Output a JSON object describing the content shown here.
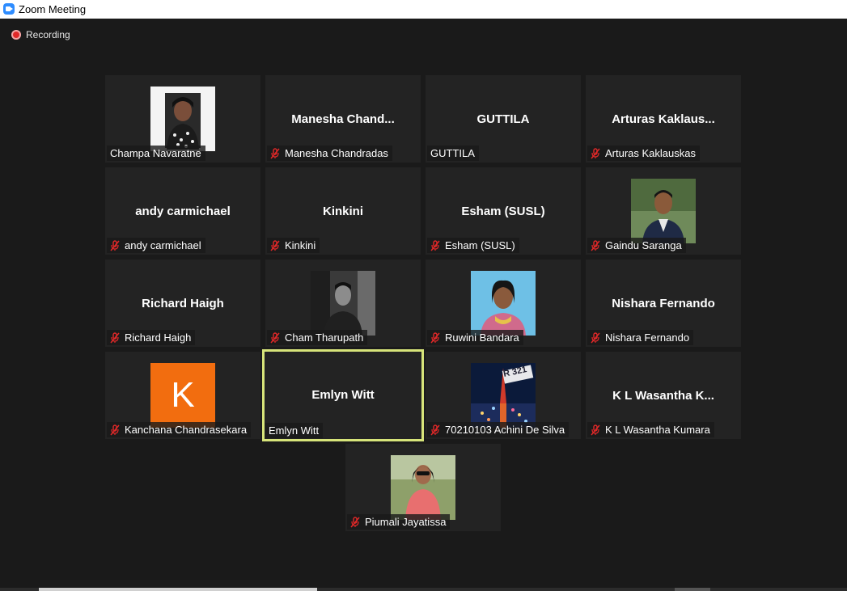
{
  "window": {
    "title": "Zoom Meeting",
    "icon": "zoom-camera-icon"
  },
  "status": {
    "recording_label": "Recording"
  },
  "participants": [
    {
      "name": "Champa Navaratne",
      "display": "photo",
      "muted": false
    },
    {
      "name": "Manesha Chandradas",
      "display": "Manesha  Chand...",
      "muted": true
    },
    {
      "name": "GUTTILA",
      "display": "GUTTILA",
      "muted": false
    },
    {
      "name": "Arturas Kaklauskas",
      "display": "Arturas  Kaklaus...",
      "muted": true
    },
    {
      "name": "andy carmichael",
      "display": "andy carmichael",
      "muted": true
    },
    {
      "name": "Kinkini",
      "display": "Kinkini",
      "muted": true
    },
    {
      "name": "Esham (SUSL)",
      "display": "Esham (SUSL)",
      "muted": true
    },
    {
      "name": "Gaindu Saranga",
      "display": "photo",
      "muted": true
    },
    {
      "name": "Richard Haigh",
      "display": "Richard Haigh",
      "muted": true
    },
    {
      "name": "Cham Tharupath",
      "display": "photo",
      "muted": true
    },
    {
      "name": "Ruwini Bandara",
      "display": "photo",
      "muted": true
    },
    {
      "name": "Nishara Fernando",
      "display": "Nishara Fernando",
      "muted": true
    },
    {
      "name": "Kanchana Chandrasekara",
      "display": "avatar",
      "avatar_letter": "K",
      "avatar_color": "#f26d0f",
      "muted": true
    },
    {
      "name": "Emlyn Witt",
      "display": "Emlyn Witt",
      "muted": false,
      "active_speaker": true
    },
    {
      "name": "70210103 Achini De Silva",
      "display": "photo",
      "photo_badge": "R 321",
      "muted": true
    },
    {
      "name": "K L Wasantha Kumara",
      "display": "K L Wasantha K...",
      "muted": true
    },
    {
      "name": "Piumali Jayatissa",
      "display": "photo",
      "muted": true
    }
  ],
  "colors": {
    "background": "#1a1a1a",
    "tile": "#232323",
    "active_border": "#d7e47a",
    "muted_icon": "#e02828"
  }
}
